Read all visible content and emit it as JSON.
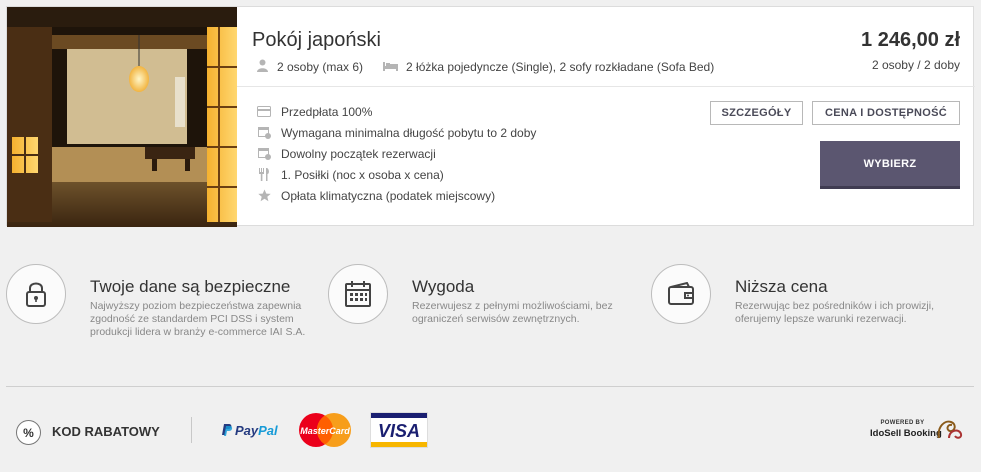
{
  "room": {
    "title": "Pokój japoński",
    "guests": "2 osoby (max 6)",
    "beds": "2 łóżka pojedyncze (Single), 2 sofy rozkładane (Sofa Bed)",
    "price": "1 246,00 zł",
    "price_sub": "2 osoby / 2 doby",
    "features": [
      {
        "icon": "credit-card-icon",
        "label": "Przedpłata 100%"
      },
      {
        "icon": "calendar-clock-icon",
        "label": "Wymagana minimalna długość pobytu to 2 doby"
      },
      {
        "icon": "calendar-clock-icon",
        "label": "Dowolny początek rezerwacji"
      },
      {
        "icon": "fork-knife-icon",
        "label": "1. Posiłki (noc x osoba x cena)"
      },
      {
        "icon": "star-icon",
        "label": "Opłata klimatyczna (podatek miejscowy)"
      }
    ],
    "buttons": {
      "details": "SZCZEGÓŁY",
      "price_availability": "CENA I DOSTĘPNOŚĆ",
      "choose": "WYBIERZ"
    },
    "photo_icon": "room-photo"
  },
  "benefits": [
    {
      "icon": "padlock-icon",
      "title": "Twoje dane są bezpieczne",
      "text": "Najwyższy poziom bezpieczeństwa zapewnia zgodność ze standardem PCI DSS i system produkcji lidera w branży e-commerce IAI S.A."
    },
    {
      "icon": "calendar-icon",
      "title": "Wygoda",
      "text": "Rezerwujesz z pełnymi możliwościami, bez ograniczeń serwisów zewnętrznych."
    },
    {
      "icon": "wallet-icon",
      "title": "Niższa cena",
      "text": "Rezerwując bez pośredników i ich prowizji, oferujemy lepsze warunki rezerwacji."
    }
  ],
  "footer": {
    "discount_symbol": "%",
    "discount_label": "KOD RABATOWY",
    "paypal_a": "Pay",
    "paypal_b": "Pal",
    "mastercard": "MasterCard",
    "visa": "VISA",
    "powered_by": "POWERED BY",
    "idosell": "IdoSell Booking"
  },
  "colors": {
    "accent": "#5b5670",
    "background": "#f0f0f0"
  }
}
